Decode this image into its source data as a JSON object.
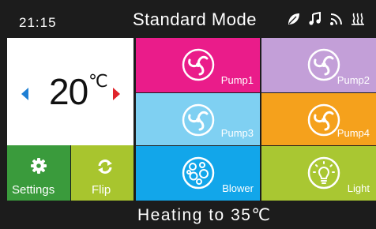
{
  "header": {
    "time": "21:15",
    "mode": "Standard Mode",
    "icons": [
      "leaf-icon",
      "music-icon",
      "wifi-icon",
      "heat-waves-icon"
    ]
  },
  "temperature": {
    "value": "20",
    "unit": "℃",
    "decrease_color": "#1e7fd4",
    "increase_color": "#e0242b"
  },
  "tiles": {
    "settings": "Settings",
    "flip": "Flip",
    "pump1": "Pump1",
    "pump2": "Pump2",
    "pump3": "Pump3",
    "pump4": "Pump4",
    "blower": "Blower",
    "light": "Light"
  },
  "colors": {
    "pump1": "#ea1c8a",
    "pump2": "#c39fd8",
    "pump3": "#7fd0f2",
    "pump4": "#f5a11c",
    "blower": "#12a6ea",
    "light": "#a9c732",
    "settings": "#3a9b3c",
    "flip": "#a8c52e"
  },
  "footer": {
    "status": "Heating to 35℃"
  }
}
